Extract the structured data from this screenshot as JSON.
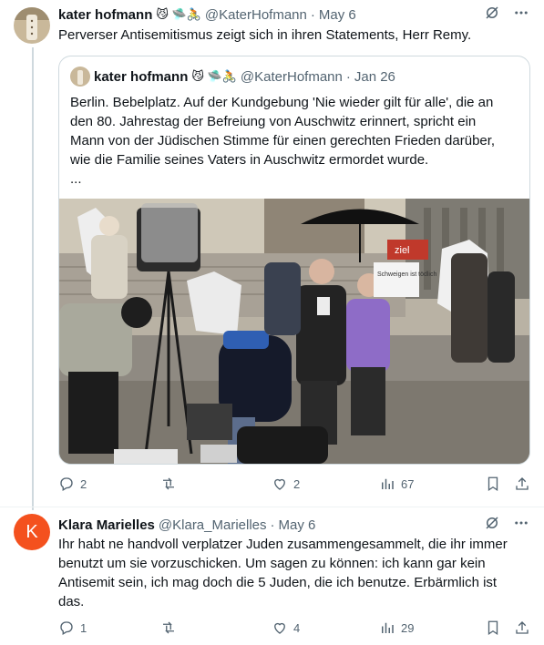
{
  "tweet1": {
    "author_name": "kater hofmann",
    "author_emoji": "😼 🛸🚴",
    "handle": "@KaterHofmann",
    "date": "May 6",
    "text": "Perverser Antisemitismus zeigt sich in ihren Statements, Herr Remy.",
    "quote": {
      "author_name": "kater hofmann",
      "author_emoji": "😼 🛸🚴",
      "handle": "@KaterHofmann",
      "date": "Jan 26",
      "text_lines": [
        "Berlin. Bebelplatz. Auf der Kundgebung 'Nie wieder gilt für alle', die an",
        "den 80. Jahrestag der Befreiung von Auschwitz erinnert, spricht ein",
        "Mann von der Jüdischen Stimme für einen gerechten Frieden darüber,",
        "wie die Familie seines Vaters in Auschwitz ermordet wurde.",
        "..."
      ],
      "photo_sign_text": "Schweigen ist tödlich",
      "photo_banner_text": "ziel"
    },
    "actions": {
      "replies": "2",
      "retweets": "",
      "likes": "2",
      "views": "67"
    }
  },
  "tweet2": {
    "avatar_letter": "K",
    "author_name": "Klara Marielles",
    "handle": "@Klara_Marielles",
    "date": "May 6",
    "text_lines": [
      "Ihr habt ne handvoll verplatzer Juden zusammengesammelt, die ihr immer",
      "benutzt um sie vorzuschicken. Um sagen zu können: ich kann gar kein",
      "Antisemit sein, ich mag doch die 5 Juden, die ich benutze. Erbärmlich ist",
      "das."
    ],
    "actions": {
      "replies": "1",
      "retweets": "",
      "likes": "4",
      "views": "29"
    }
  },
  "colors": {
    "text": "#0f1419",
    "muted": "#536471",
    "border": "#cfd9de",
    "avatar_k": "#f4511e"
  }
}
